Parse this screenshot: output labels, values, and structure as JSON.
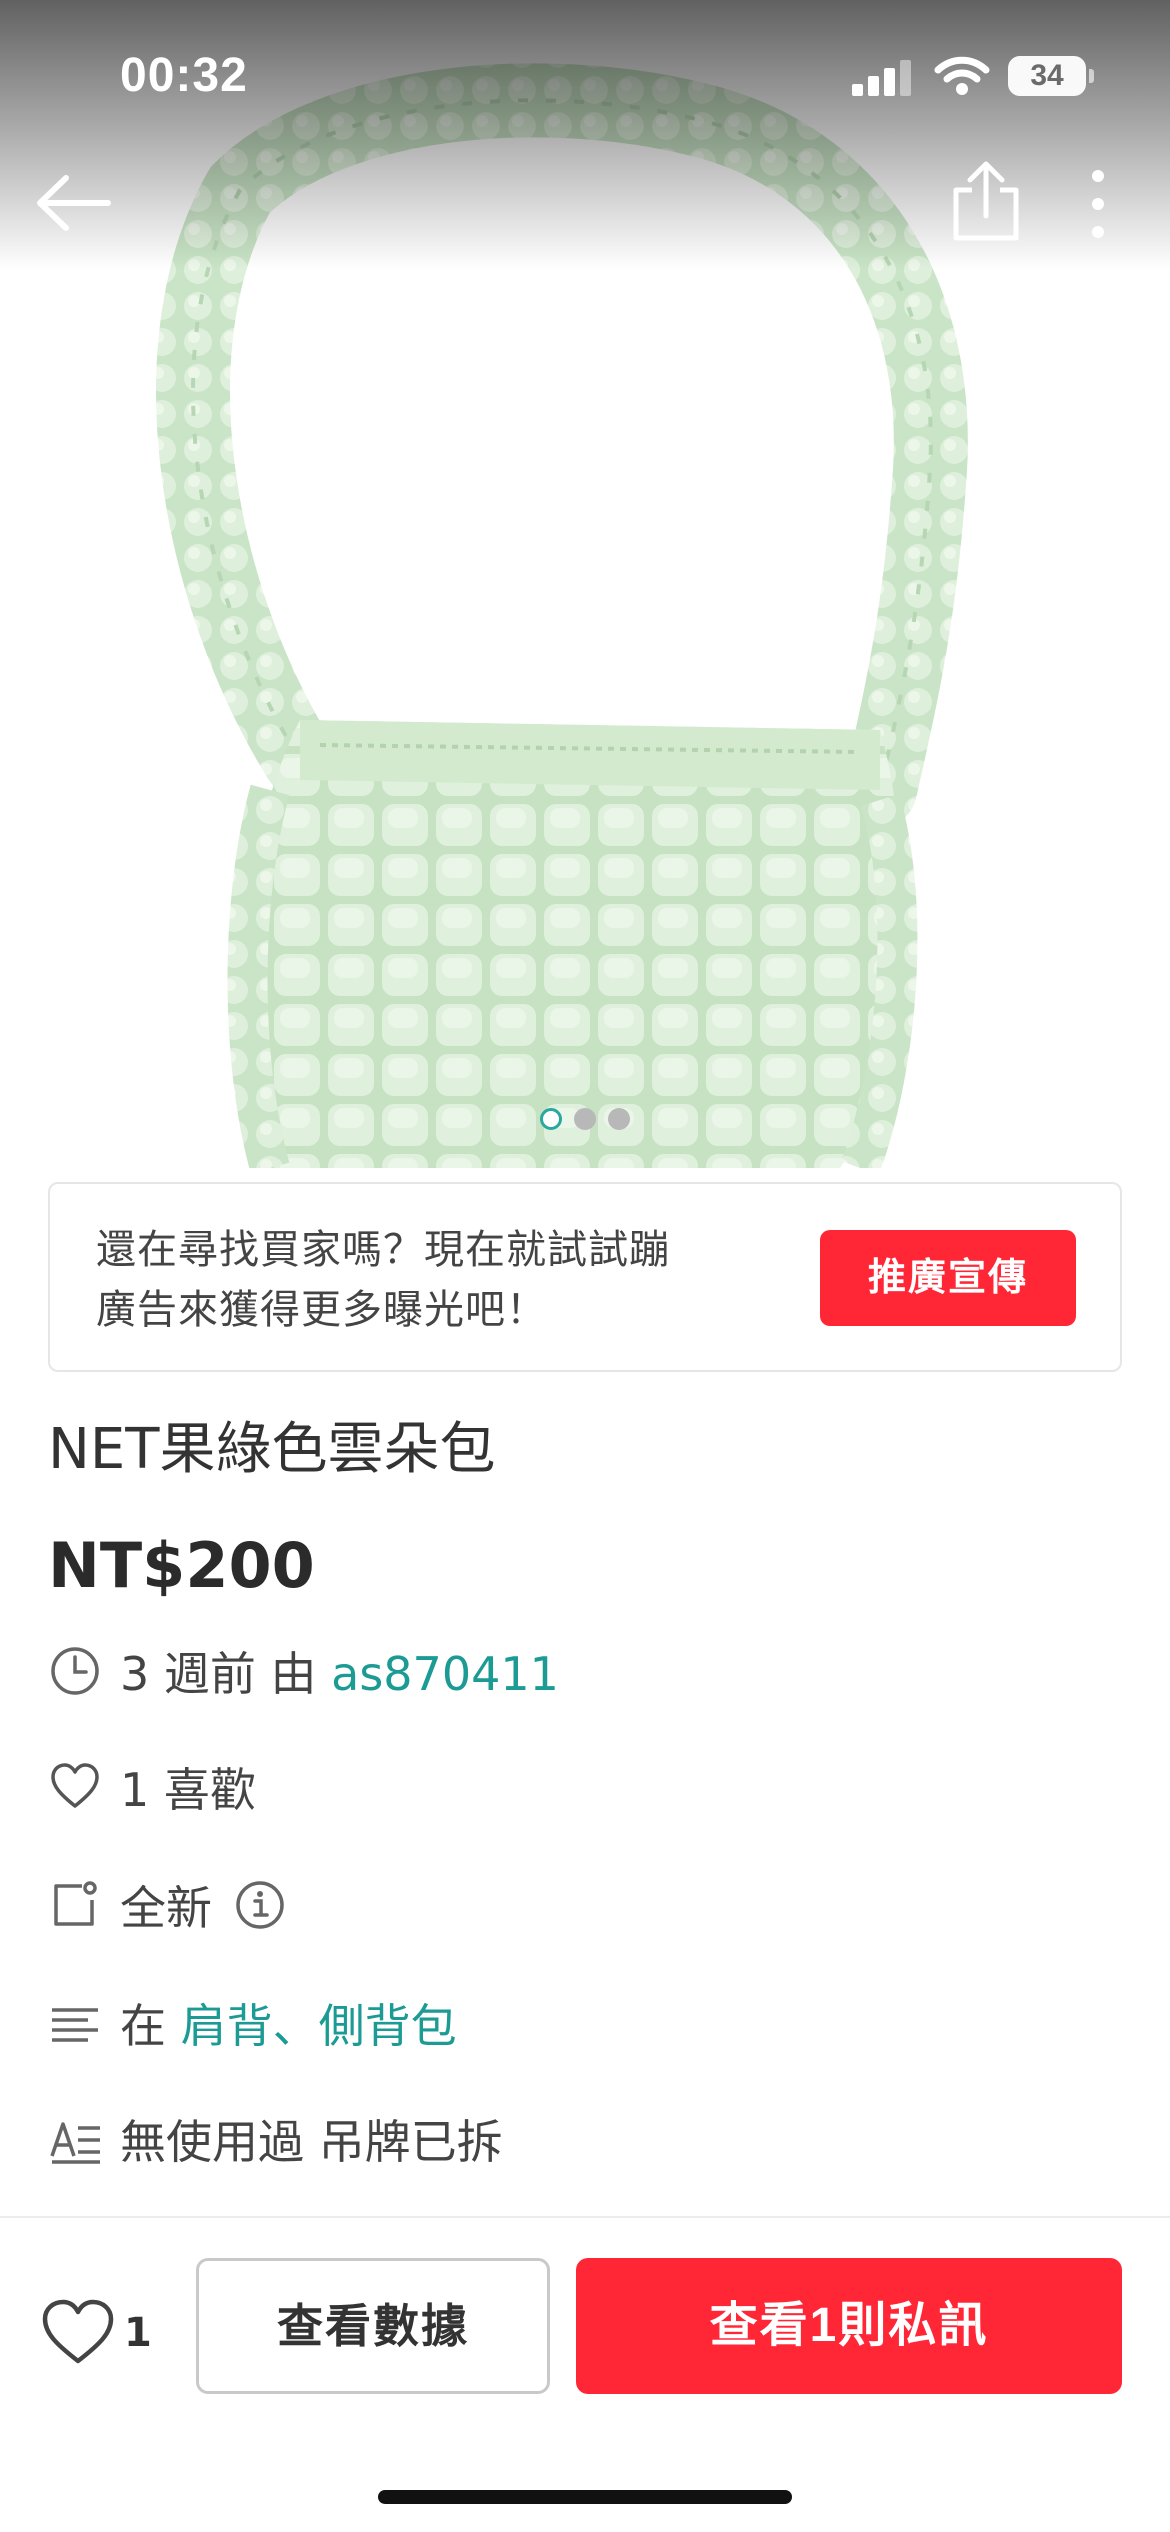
{
  "status_bar": {
    "time": "00:32",
    "battery_level": "34",
    "icons": [
      "signal-icon",
      "wifi-icon",
      "battery-icon"
    ]
  },
  "nav": {
    "icons": [
      "back-arrow-icon",
      "share-icon",
      "more-vertical-icon"
    ]
  },
  "gallery": {
    "image_count": 3,
    "active_index": 0,
    "image_description_colors": {
      "bag": "#d8ecd6",
      "bag_shadow": "#b9d9b6",
      "background": "#ffffff"
    }
  },
  "promo": {
    "text_line1": "還在尋找買家嗎？現在就試試蹦",
    "text_line2": "廣告來獲得更多曝光吧！",
    "button_label": "推廣宣傳"
  },
  "listing": {
    "title": "NET果綠色雲朵包",
    "price": "NT$200",
    "posted": {
      "time_ago": "3 週前 由 ",
      "seller": "as870411"
    },
    "likes": "1 喜歡",
    "condition": "全新",
    "category": {
      "prefix": "在 ",
      "value": "肩背、側背包"
    },
    "description": "無使用過 吊牌已拆"
  },
  "bottom_bar": {
    "like_count": "1",
    "stats_button": "查看數據",
    "messages_button": "查看1則私訊"
  },
  "colors": {
    "accent_red": "#ff2636",
    "link_teal": "#1c9b94",
    "text": "#333333"
  }
}
